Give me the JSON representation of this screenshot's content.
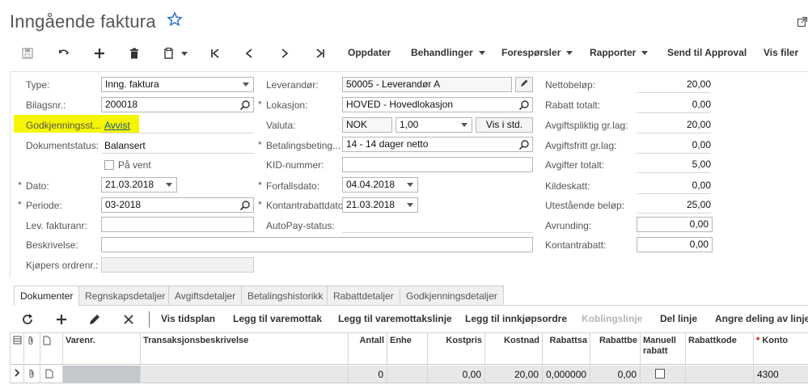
{
  "page": {
    "title": "Inngående faktura"
  },
  "toolbar": {
    "oppdater": "Oppdater",
    "behandlinger": "Behandlinger",
    "foresporsler": "Forespørsler",
    "rapporter": "Rapporter",
    "send_approval": "Send til Approval",
    "vis_filer": "Vis filer"
  },
  "form": {
    "type_label": "Type:",
    "type_value": "Inng. faktura",
    "bilagsnr_label": "Bilagsnr.:",
    "bilagsnr_value": "200018",
    "godkjenning_label": "Godkjenningsst...",
    "godkjenning_value": "Avvist",
    "dokstatus_label": "Dokumentstatus:",
    "dokstatus_value": "Balansert",
    "pavent_label": "På vent",
    "dato_label": "Dato:",
    "dato_value": "21.03.2018",
    "periode_label": "Periode:",
    "periode_value": "03-2018",
    "levfaktura_label": "Lev. fakturanr:",
    "beskrivelse_label": "Beskrivelse:",
    "kjopers_label": "Kjøpers ordrenr.:",
    "leverandor_label": "Leverandør:",
    "leverandor_value": "50005 - Leverandør A",
    "lokasjon_label": "Lokasjon:",
    "lokasjon_value": "HOVED - Hovedlokasjon",
    "valuta_label": "Valuta:",
    "valuta_value": "NOK",
    "kurs_value": "1,00",
    "vis_std": "Vis i std.",
    "betaling_label": "Betalingsbeting...",
    "betaling_value": "14 - 14 dager netto",
    "kid_label": "KID-nummer:",
    "forfall_label": "Forfallsdato:",
    "forfall_value": "04.04.2018",
    "kontantdato_label": "Kontantrabattdato:",
    "kontantdato_value": "21.03.2018",
    "autopay_label": "AutoPay-status:",
    "netto_label": "Nettobeløp:",
    "netto_value": "20,00",
    "rabatt_totalt_label": "Rabatt totalt:",
    "rabatt_totalt_value": "0,00",
    "avg_grlag_label": "Avgiftspliktig gr.lag:",
    "avg_grlag_value": "20,00",
    "avgfritt_label": "Avgiftsfritt gr.lag:",
    "avgfritt_value": "0,00",
    "avg_totalt_label": "Avgifter totalt:",
    "avg_totalt_value": "5,00",
    "kildeskatt_label": "Kildeskatt:",
    "kildeskatt_value": "0,00",
    "utestaende_label": "Utestående beløp:",
    "utestaende_value": "25,00",
    "avrunding_label": "Avrunding:",
    "avrunding_value": "0,00",
    "kontantrabatt_label": "Kontantrabatt:",
    "kontantrabatt_value": "0,00",
    "required_mark": "*"
  },
  "tabs": [
    "Dokumenter",
    "Regnskapsdetaljer",
    "Avgiftsdetaljer",
    "Betalingshistorikk",
    "Rabattdetaljer",
    "Godkjenningsdetaljer"
  ],
  "grid_toolbar": {
    "vis_tidsplan": "Vis tidsplan",
    "legg_varemottak": "Legg til varemottak",
    "legg_varemottakslinje": "Legg til varemottakslinje",
    "legg_innkjop": "Legg til innkjøpsordre",
    "koblingslinje": "Koblingslinje",
    "del_linje": "Del linje",
    "angre_deling": "Angre deling av linje"
  },
  "grid": {
    "headers": {
      "varenr": "Varenr.",
      "beskrivelse": "Transaksjonsbeskrivelse",
      "antall": "Antall",
      "enhet": "Enhe",
      "kostpris": "Kostpris",
      "kostnad": "Kostnad",
      "rabattsats": "Rabattsa",
      "rabattbelop": "Rabattbe",
      "manuell_rabatt": "Manuell rabatt",
      "rabattkode": "Rabattkode",
      "konto": "Konto",
      "required_mark": "*"
    },
    "row": {
      "antall": "0",
      "kostpris": "0,00",
      "kostnad": "20,00",
      "rabattsats": "0,000000",
      "rabattbelop": "0,00",
      "konto": "4300"
    }
  },
  "colors": {
    "highlight": "#f5f500",
    "link": "#1a4fa0"
  }
}
